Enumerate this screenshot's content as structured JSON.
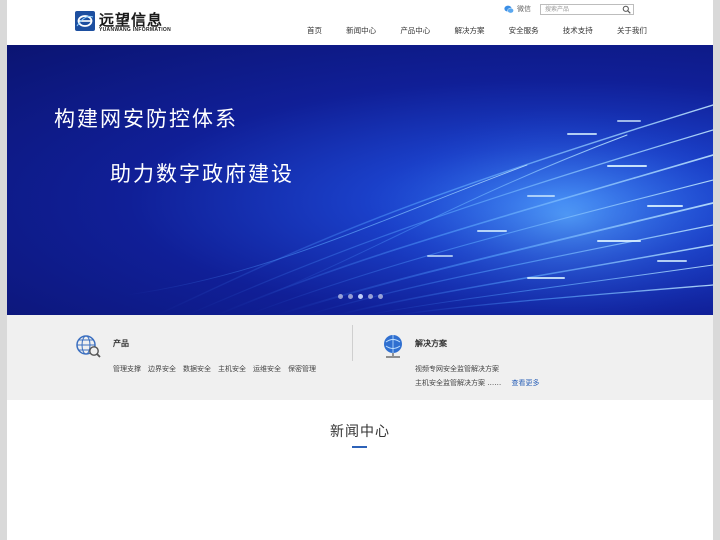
{
  "header": {
    "logo": {
      "cn": "远望信息",
      "en": "YUANWANG INFORMATION"
    },
    "wechat_label": "微信",
    "search": {
      "placeholder": "搜索产品"
    },
    "nav": [
      "首页",
      "新闻中心",
      "产品中心",
      "解决方案",
      "安全服务",
      "技术支持",
      "关于我们"
    ]
  },
  "banner": {
    "line1": "构建网安防控体系",
    "line2": "助力数字政府建设",
    "slides": 5,
    "active_slide": 2
  },
  "features": {
    "products": {
      "title": "产品",
      "links": [
        "管理支撑",
        "边界安全",
        "数据安全",
        "主机安全",
        "运维安全",
        "保密管理"
      ]
    },
    "solutions": {
      "title": "解决方案",
      "items": [
        "视频专网安全监管解决方案",
        "主机安全监管解决方案 ……"
      ],
      "more": "查看更多"
    }
  },
  "news": {
    "title": "新闻中心"
  },
  "colors": {
    "accent": "#2d62b8",
    "banner_dark": "#0b1472",
    "brand": "#1d4fa0"
  }
}
